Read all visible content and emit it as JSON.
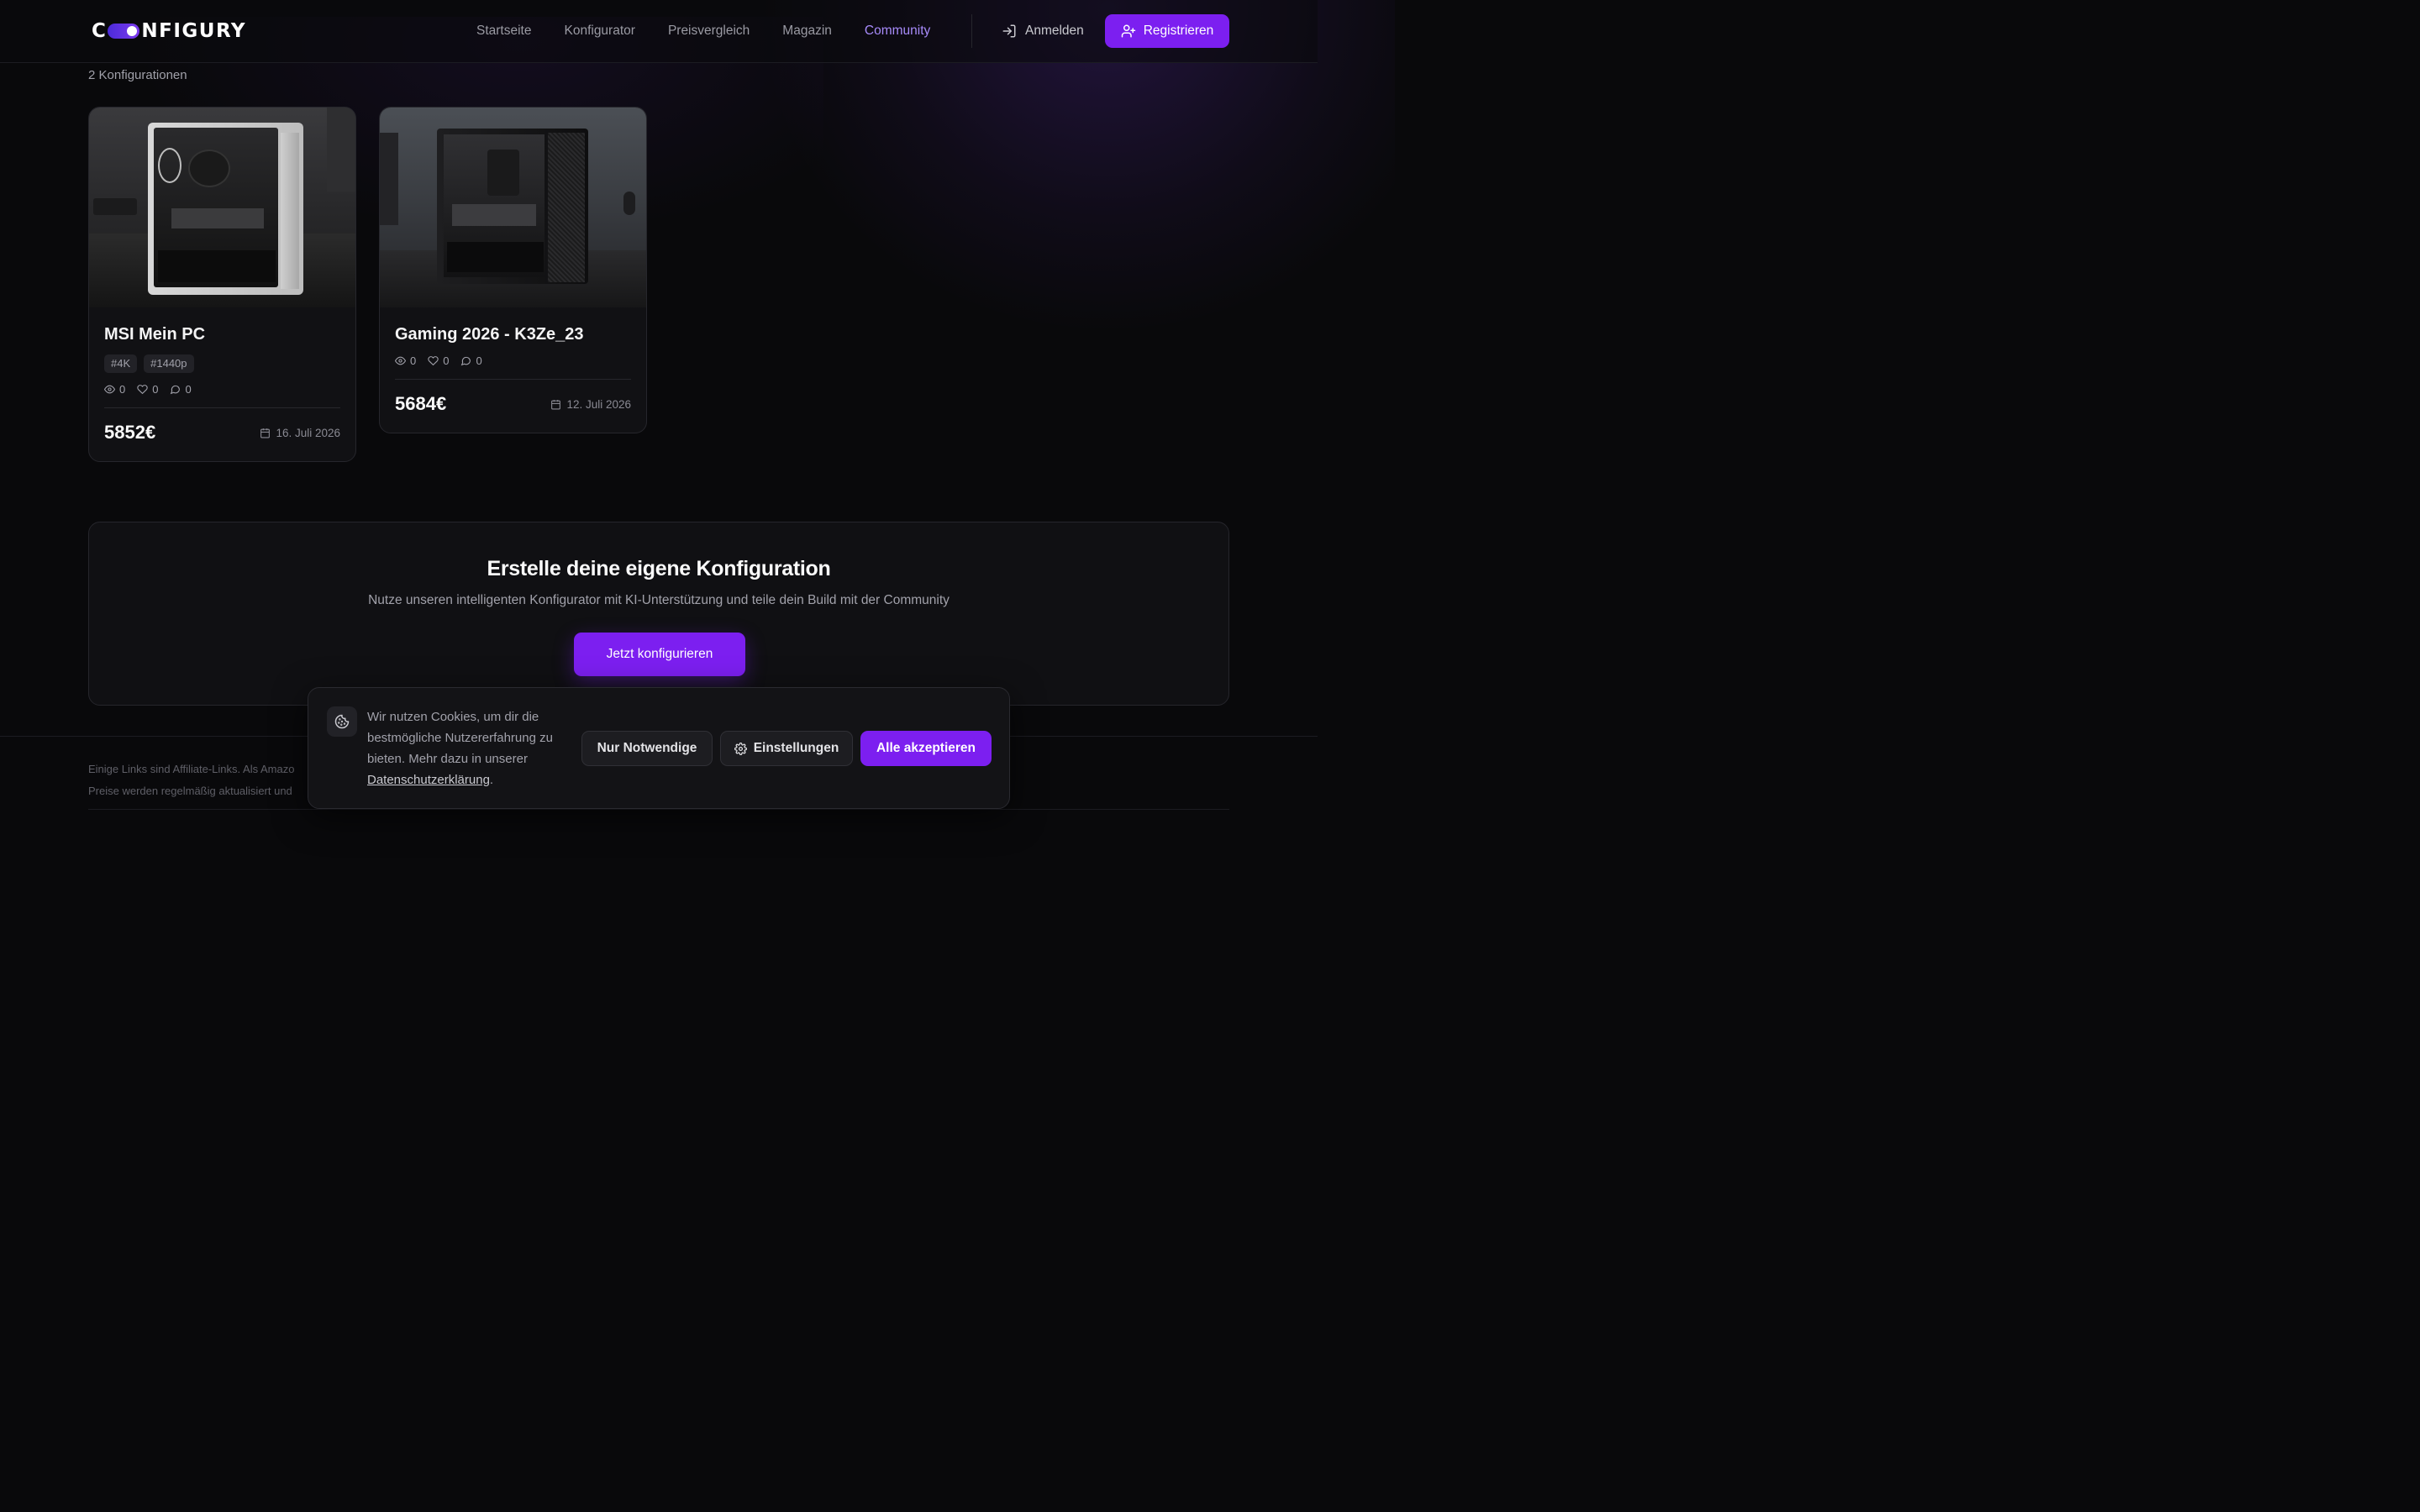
{
  "header": {
    "logo_text_left": "C",
    "logo_text_right": "NFIGURY",
    "nav": [
      {
        "label": "Startseite",
        "active": false
      },
      {
        "label": "Konfigurator",
        "active": false
      },
      {
        "label": "Preisvergleich",
        "active": false
      },
      {
        "label": "Magazin",
        "active": false
      },
      {
        "label": "Community",
        "active": true
      }
    ],
    "login_label": "Anmelden",
    "register_label": "Registrieren"
  },
  "results": {
    "count_label": "2 Konfigurationen"
  },
  "cards": [
    {
      "title": "MSI Mein PC",
      "tags": [
        "#4K",
        "#1440p"
      ],
      "views": "0",
      "likes": "0",
      "comments": "0",
      "price": "5852€",
      "date": "16. Juli 2026",
      "image": "white-pc-case-photo"
    },
    {
      "title": "Gaming 2026 - K3Ze_23",
      "tags": [],
      "views": "0",
      "likes": "0",
      "comments": "0",
      "price": "5684€",
      "date": "12. Juli 2026",
      "image": "black-pc-case-photo"
    }
  ],
  "cta": {
    "title": "Erstelle deine eigene Konfiguration",
    "subtitle": "Nutze unseren intelligenten Konfigurator mit KI-Unterstützung und teile dein Build mit der Community",
    "button_label": "Jetzt konfigurieren"
  },
  "footer": {
    "line1": "Einige Links sind Affiliate-Links. Als Amazo",
    "line2": "Preise werden regelmäßig aktualisiert und"
  },
  "cookie_banner": {
    "text": "Wir nutzen Cookies, um dir die bestmögliche Nutzererfahrung zu bieten. Mehr dazu in unserer",
    "link_label": "Datenschutzerklärung",
    "link_suffix": ".",
    "necessary_label": "Nur Notwendige",
    "settings_label": "Einstellungen",
    "accept_label": "Alle akzeptieren"
  },
  "colors": {
    "accent": "#7c1ff0",
    "nav_active": "#a78bfa",
    "background": "#09090b"
  }
}
